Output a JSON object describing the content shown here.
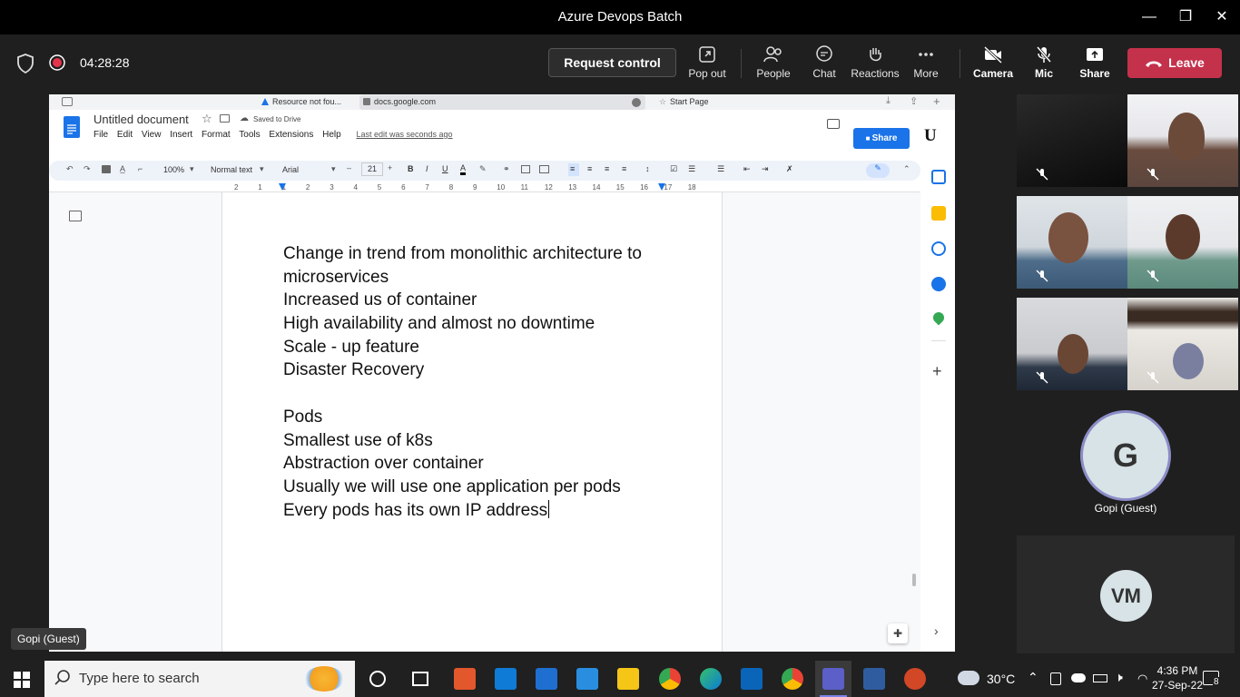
{
  "window": {
    "title": "Azure Devops Batch",
    "minimize_glyph": "—",
    "restore_glyph": "❐",
    "close_glyph": "✕"
  },
  "meeting": {
    "timer": "04:28:28",
    "request_control": "Request control",
    "buttons": {
      "popout": "Pop out",
      "people": "People",
      "chat": "Chat",
      "reactions": "Reactions",
      "more": "More",
      "camera": "Camera",
      "mic": "Mic",
      "share": "Share"
    },
    "leave": "Leave"
  },
  "browser": {
    "tabs": [
      {
        "label": "Resource not fou..."
      },
      {
        "label": "docs.google.com"
      },
      {
        "label": "Start Page"
      }
    ]
  },
  "gdocs": {
    "doc_title": "Untitled document",
    "saved_status": "Saved to Drive",
    "menu": [
      "File",
      "Edit",
      "View",
      "Insert",
      "Format",
      "Tools",
      "Extensions",
      "Help"
    ],
    "last_edit": "Last edit was seconds ago",
    "share": "Share",
    "toolbar": {
      "zoom": "100%",
      "style": "Normal text",
      "font": "Arial",
      "font_size": "21"
    },
    "ruler_numbers": [
      "2",
      "1",
      "1",
      "2",
      "3",
      "4",
      "5",
      "6",
      "7",
      "8",
      "9",
      "10",
      "11",
      "12",
      "13",
      "14",
      "15",
      "16",
      "17",
      "18"
    ],
    "body_lines": [
      "Change in trend from monolithic architecture to",
      "microservices",
      "Increased us of container",
      "High availability and almost no downtime",
      "Scale - up feature",
      "Disaster Recovery",
      "",
      "Pods",
      "Smallest use of k8s",
      "Abstraction over container",
      "Usually we will use one application per pods",
      "Every pods has its own IP address"
    ]
  },
  "participants": {
    "g_initial": "G",
    "g_name": "Gopi (Guest)",
    "vm_initials": "VM",
    "active_speaker_label": "Gopi (Guest)"
  },
  "taskbar": {
    "search_placeholder": "Type here to search",
    "temperature": "30°C",
    "time": "4:36 PM",
    "date": "27-Sep-22",
    "notification_count": "8"
  },
  "colors": {
    "leave_red": "#c4314b",
    "gdocs_blue": "#1a73e8",
    "teams_purple": "#5b5fc7"
  }
}
